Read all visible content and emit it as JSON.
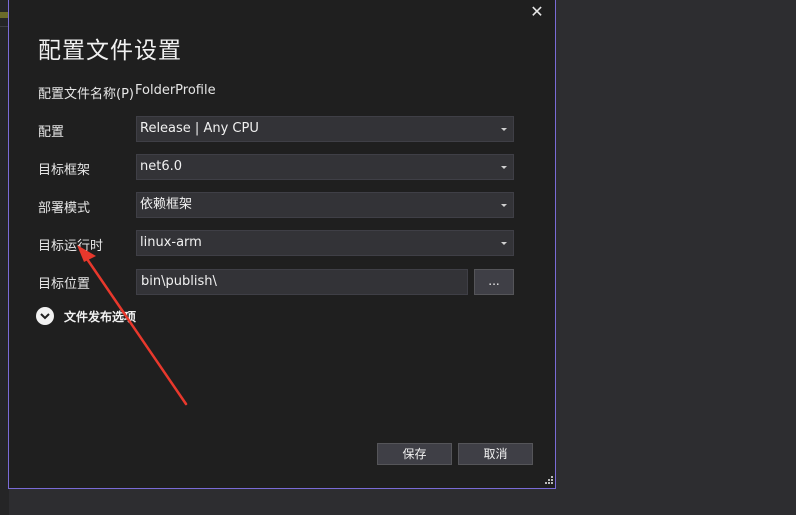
{
  "dialog": {
    "title": "配置文件设置",
    "close_glyph": "✕",
    "fields": {
      "profile_name": {
        "label": "配置文件名称(P)",
        "value": "FolderProfile"
      },
      "configuration": {
        "label": "配置",
        "value": "Release | Any CPU"
      },
      "target_framework": {
        "label": "目标框架",
        "value": "net6.0"
      },
      "deployment_mode": {
        "label": "部署模式",
        "value": "依赖框架"
      },
      "target_runtime": {
        "label": "目标运行时",
        "value": "linux-arm"
      },
      "target_location": {
        "label": "目标位置",
        "value": "bin\\publish\\",
        "browse_label": "..."
      }
    },
    "expander_label": "文件发布选项",
    "buttons": {
      "save": "保存",
      "cancel": "取消"
    }
  },
  "colors": {
    "annotation_arrow": "#e8382c",
    "dialog_border": "#7a6bd6"
  }
}
